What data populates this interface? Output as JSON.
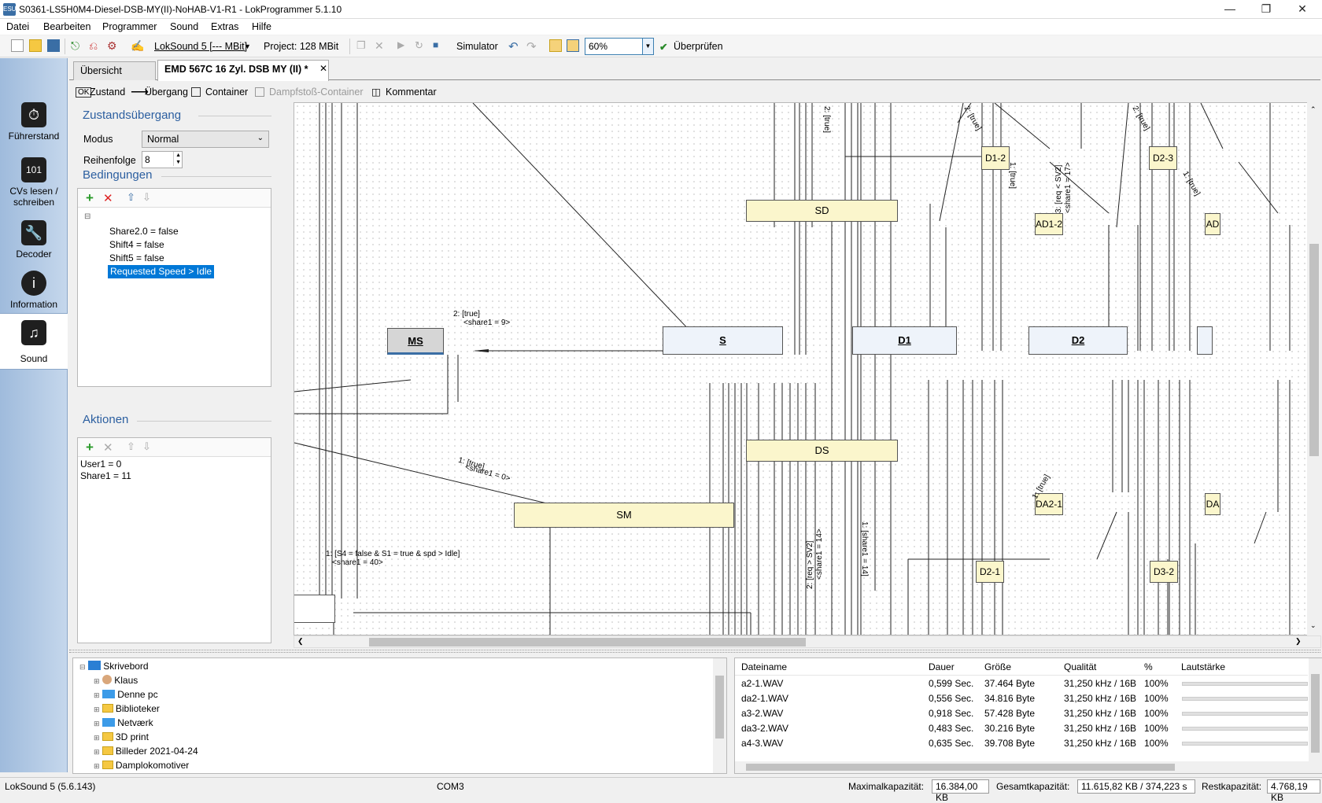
{
  "window": {
    "title": "S0361-LS5H0M4-Diesel-DSB-MY(II)-NoHAB-V1-R1 - LokProgrammer 5.1.10"
  },
  "menu": [
    "Datei",
    "Bearbeiten",
    "Programmer",
    "Sound",
    "Extras",
    "Hilfe"
  ],
  "toolbar": {
    "decoder": "LokSound 5 [--- MBit]",
    "project": "Project:  128 MBit",
    "simulator": "Simulator",
    "zoom": "60%",
    "check": "Überprüfen"
  },
  "nav": [
    {
      "label": "Führerstand",
      "icon": "cab-icon"
    },
    {
      "label": "CVs lesen / schreiben",
      "icon": "cv-icon"
    },
    {
      "label": "Decoder",
      "icon": "wrench-icon"
    },
    {
      "label": "Information",
      "icon": "info-icon"
    },
    {
      "label": "Sound",
      "icon": "music-icon"
    }
  ],
  "tabs": [
    "Übersicht",
    "EMD 567C 16 Zyl. DSB MY (II) *"
  ],
  "subtoolbar": [
    "Zustand",
    "Übergang",
    "Container",
    "Dampfstoß-Container",
    "Kommentar"
  ],
  "panel": {
    "title": "Zustandsübergang",
    "modus_label": "Modus",
    "modus_value": "Normal",
    "order_label": "Reihenfolge",
    "order_value": "8",
    "conditions_title": "Bedingungen",
    "conditions": [
      "Share2.0 = false",
      "Shift4 = false",
      "Shift5 = false",
      "Requested Speed > Idle"
    ],
    "actions_title": "Aktionen",
    "actions": [
      "User1 = 0",
      "Share1 = 11"
    ]
  },
  "diagram": {
    "states": {
      "ms": "MS",
      "s": "S",
      "d1": "D1",
      "d2": "D2",
      "sd": "SD",
      "ds": "DS",
      "sm": "SM",
      "d12": "D1-2",
      "d23": "D2-3",
      "ad12": "AD1-2",
      "ad": "AD",
      "da21": "DA2-1",
      "da": "DA",
      "d21": "D2-1",
      "d32": "D3-2"
    },
    "labels": {
      "l1": "2: [true]",
      "l2": "<share1 = 9>",
      "l3": "1: [true]",
      "l4": "<share1 = 0>",
      "l5": "1: [S4 = false & S1 = true & spd > Idle]",
      "l6": "<share1 = 40>",
      "l7": "2: [true]",
      "l8": "1: [true]",
      "l9": "1: [share1 = 14]",
      "l10": "2: [req > SV2]",
      "l11": "<share1 = 14>",
      "l12": "1: [true]",
      "l13": "2: [true]",
      "l14": "2: [true]",
      "l15": "1: [true]",
      "l16": "3: [req < SV2]",
      "l17": "<share1 = 17>"
    }
  },
  "files": {
    "tree": [
      "Skrivebord",
      "Klaus",
      "Denne pc",
      "Biblioteker",
      "Netværk",
      "3D print",
      "Billeder 2021-04-24",
      "Damplokomotiver"
    ],
    "columns": [
      "Dateiname",
      "Dauer",
      "Größe",
      "Qualität",
      "%",
      "Lautstärke"
    ],
    "rows": [
      [
        "a2-1.WAV",
        "0,599 Sec.",
        "37.464 Byte",
        "31,250 kHz / 16B",
        "100%"
      ],
      [
        "da2-1.WAV",
        "0,556 Sec.",
        "34.816 Byte",
        "31,250 kHz / 16B",
        "100%"
      ],
      [
        "a3-2.WAV",
        "0,918 Sec.",
        "57.428 Byte",
        "31,250 kHz / 16B",
        "100%"
      ],
      [
        "da3-2.WAV",
        "0,483 Sec.",
        "30.216 Byte",
        "31,250 kHz / 16B",
        "100%"
      ],
      [
        "a4-3.WAV",
        "0,635 Sec.",
        "39.708 Byte",
        "31,250 kHz / 16B",
        "100%"
      ]
    ]
  },
  "status": {
    "version": "LokSound 5 (5.6.143)",
    "port": "COM3",
    "max_label": "Maximalkapazität:",
    "max": "16.384,00 KB",
    "total_label": "Gesamtkapazität:",
    "total": "11.615,82 KB / 374,223 s",
    "rest_label": "Restkapazität:",
    "rest": "4.768,19 KB"
  }
}
